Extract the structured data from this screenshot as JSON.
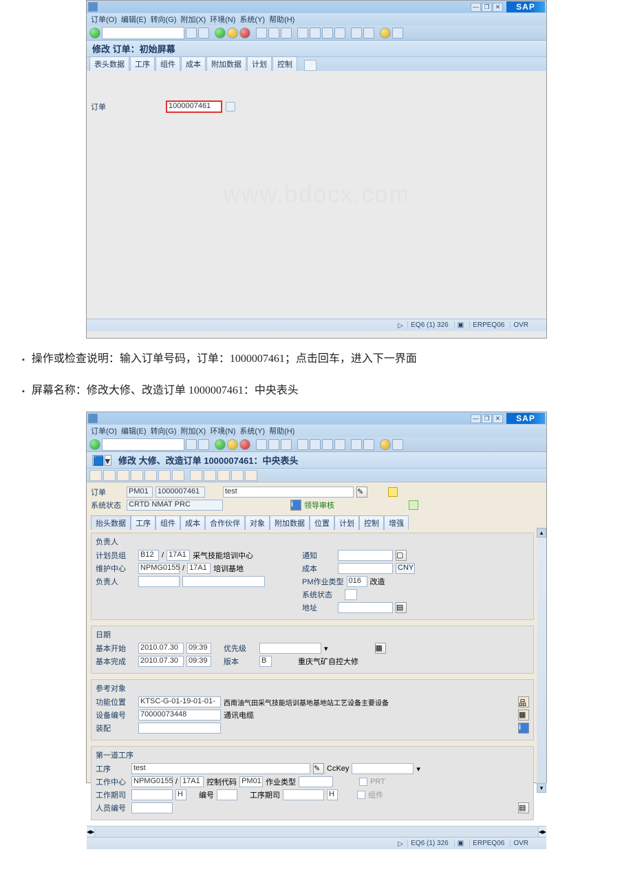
{
  "doc": {
    "bullet1_pre": "操作或检查说明：输入订单号码，订单：",
    "bullet1_ord": "1000007461",
    "bullet1_post": "；点击回车，进入下一界面",
    "bullet2_pre": "屏幕名称：修改大修、改造订单 ",
    "bullet2_ord": "1000007461",
    "bullet2_post": "：中央表头"
  },
  "win1": {
    "menu": {
      "order": "订单(O)",
      "edit": "编辑(E)",
      "goto": "转向(G)",
      "extra": "附加(X)",
      "env": "环境(N)",
      "sys": "系统(Y)",
      "help": "帮助(H)"
    },
    "title": "修改 订单：初始屏幕",
    "tabs": {
      "hdr": "表头数据",
      "op": "工序",
      "comp": "组件",
      "cost": "成本",
      "attach": "附加数据",
      "plan": "计划",
      "ctrl": "控制"
    },
    "order_label": "订单",
    "order_value": "1000007461",
    "statusbar": {
      "sys": "EQ6 (1) 326",
      "server": "ERPEQ06",
      "mode": "OVR"
    },
    "watermark": "www.bdocx.com"
  },
  "win2": {
    "menu": {
      "order": "订单(O)",
      "edit": "编辑(E)",
      "goto": "转向(G)",
      "extra": "附加(X)",
      "env": "环境(N)",
      "sys": "系统(Y)",
      "help": "帮助(H)"
    },
    "title": "修改 大修、改造订单 1000007461：中央表头",
    "orderrow": {
      "label": "订单",
      "type": "PM01",
      "no": "1000007461",
      "desc": "test",
      "approve": "领导审核"
    },
    "statusrow": {
      "label": "系统状态",
      "val": "CRTD NMAT PRC"
    },
    "tabs": {
      "hdr": "抬头数据",
      "op": "工序",
      "comp": "组件",
      "cost": "成本",
      "partner": "合作伙伴",
      "obj": "对象",
      "attach": "附加数据",
      "loc": "位置",
      "plan": "计划",
      "ctrl": "控制",
      "enh": "增强"
    },
    "grp_resp": {
      "title": "负责人",
      "plnr_lab": "计划员组",
      "plnr_a": "B12",
      "plnr_b": "17A1",
      "plnr_desc": "采气技能培训中心",
      "wc_lab": "维护中心",
      "wc_a": "NPMG0155",
      "wc_b": "17A1",
      "wc_desc": "培训基地",
      "resp_lab": "负责人",
      "notif_lab": "通知",
      "cost_lab": "成本",
      "cost_curr": "CNY",
      "acttype_lab": "PM作业类型",
      "acttype_a": "016",
      "acttype_b": "改造",
      "sysstat_lab": "系统状态",
      "addr_lab": "地址"
    },
    "grp_date": {
      "title": "日期",
      "bs_lab": "基本开始",
      "bs_d": "2010.07.30",
      "bs_t": "09:39",
      "prio": "优先级",
      "be_lab": "基本完成",
      "be_d": "2010.07.30",
      "be_t": "09:39",
      "ver": "版本",
      "ver_v": "B",
      "ver_desc": "重庆气矿自控大修"
    },
    "grp_ref": {
      "title": "参考对象",
      "fl_lab": "功能位置",
      "fl_v": "KTSC-G-01-19-01-01-",
      "fl_desc": "西南油气田采气技能培训基地基地站工艺设备主要设备",
      "eq_lab": "设备编号",
      "eq_v": "70000073448",
      "eq_desc": "通讯电缆",
      "asm_lab": "装配"
    },
    "grp_op": {
      "title": "第一道工序",
      "op_lab": "工序",
      "op_v": "test",
      "cckey": "CcKey",
      "wc_lab": "工作中心",
      "wc_a": "NPMG0155",
      "wc_b": "17A1",
      "ctrlkey": "控制代码",
      "ctrlkey_v": "PM01",
      "acttype": "作业类型",
      "prt": "PRT",
      "dur_lab": "工作期司",
      "dur_u": "H",
      "no": "编号",
      "opdur": "工序期司",
      "opdur_u": "H",
      "comp": "组件",
      "per_lab": "人员编号"
    },
    "statusbar": {
      "sys": "EQ6 (1) 326",
      "server": "ERPEQ06",
      "mode": "OVR"
    }
  }
}
